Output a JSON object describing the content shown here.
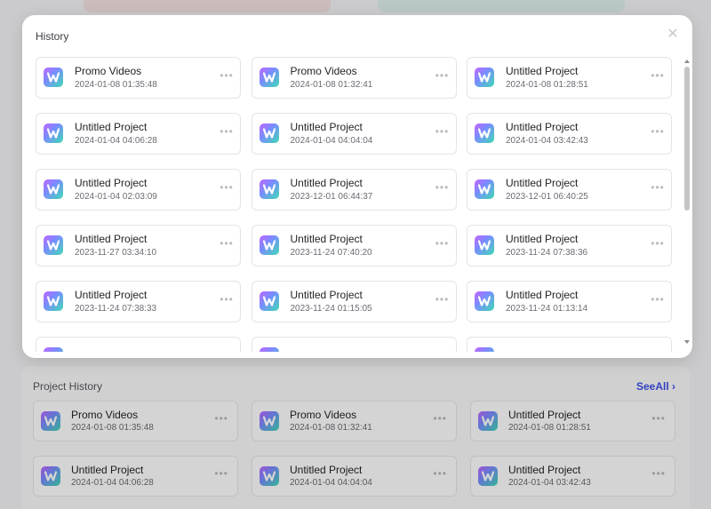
{
  "modal": {
    "title": "History",
    "close_icon": "close-icon",
    "items": [
      {
        "name": "Promo Videos",
        "time": "2024-01-08 01:35:48"
      },
      {
        "name": "Promo Videos",
        "time": "2024-01-08 01:32:41"
      },
      {
        "name": "Untitled Project",
        "time": "2024-01-08 01:28:51"
      },
      {
        "name": "Untitled Project",
        "time": "2024-01-04 04:06:28"
      },
      {
        "name": "Untitled Project",
        "time": "2024-01-04 04:04:04"
      },
      {
        "name": "Untitled Project",
        "time": "2024-01-04 03:42:43"
      },
      {
        "name": "Untitled Project",
        "time": "2024-01-04 02:03:09"
      },
      {
        "name": "Untitled Project",
        "time": "2023-12-01 06:44:37"
      },
      {
        "name": "Untitled Project",
        "time": "2023-12-01 06:40:25"
      },
      {
        "name": "Untitled Project",
        "time": "2023-11-27 03:34:10"
      },
      {
        "name": "Untitled Project",
        "time": "2023-11-24 07:40:20"
      },
      {
        "name": "Untitled Project",
        "time": "2023-11-24 07:38:36"
      },
      {
        "name": "Untitled Project",
        "time": "2023-11-24 07:38:33"
      },
      {
        "name": "Untitled Project",
        "time": "2023-11-24 01:15:05"
      },
      {
        "name": "Untitled Project",
        "time": "2023-11-24 01:13:14"
      },
      {
        "name": "",
        "time": ""
      },
      {
        "name": "",
        "time": ""
      },
      {
        "name": "",
        "time": ""
      }
    ],
    "more_icon": "more-horizontal-icon"
  },
  "background": {
    "section_title": "Project History",
    "see_all": "SeeAll",
    "items": [
      {
        "name": "Promo Videos",
        "time": "2024-01-08 01:35:48"
      },
      {
        "name": "Promo Videos",
        "time": "2024-01-08 01:32:41"
      },
      {
        "name": "Untitled Project",
        "time": "2024-01-08 01:28:51"
      },
      {
        "name": "Untitled Project",
        "time": "2024-01-04 04:06:28"
      },
      {
        "name": "Untitled Project",
        "time": "2024-01-04 04:04:04"
      },
      {
        "name": "Untitled Project",
        "time": "2024-01-04 03:42:43"
      }
    ]
  },
  "colors": {
    "accent": "#3d4ee8",
    "icon_gradient": [
      "#c264ff",
      "#7a8cff",
      "#3fd9b6"
    ]
  }
}
